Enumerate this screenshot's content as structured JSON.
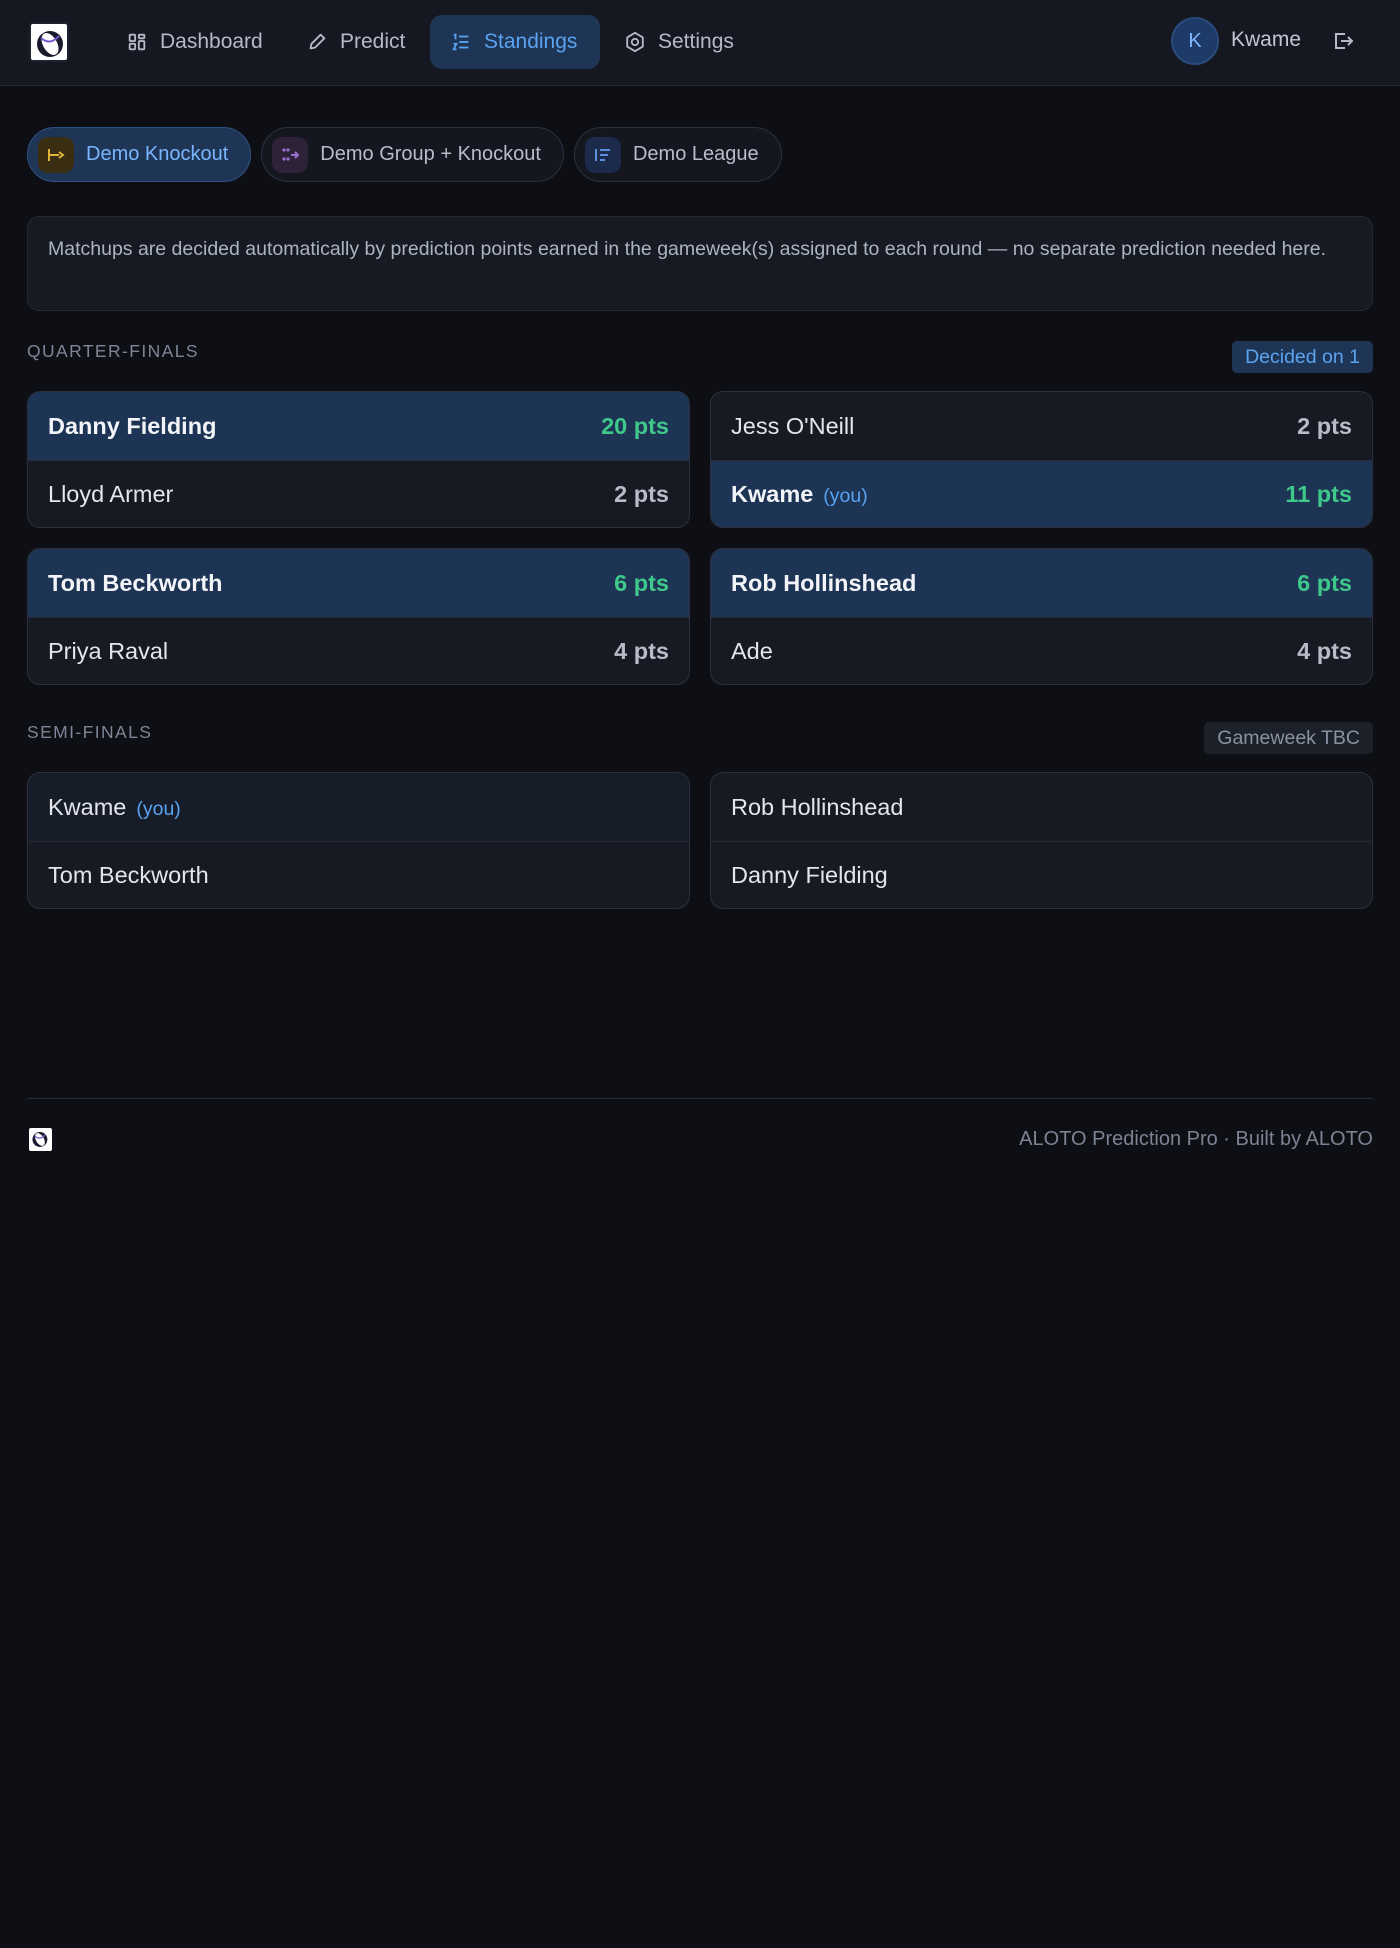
{
  "nav": {
    "items": [
      {
        "label": "Dashboard",
        "icon": "dashboard-icon"
      },
      {
        "label": "Predict",
        "icon": "pencil-icon"
      },
      {
        "label": "Standings",
        "icon": "list-ordered-icon",
        "active": true
      },
      {
        "label": "Settings",
        "icon": "gear-icon"
      }
    ],
    "user": {
      "initial": "K",
      "name": "Kwame"
    }
  },
  "tabs": [
    {
      "label": "Demo Knockout",
      "icon": "bracket-icon",
      "active": true
    },
    {
      "label": "Demo Group + Knockout",
      "icon": "group-knockout-icon"
    },
    {
      "label": "Demo League",
      "icon": "league-table-icon"
    }
  ],
  "info_text": "Matchups are decided automatically by prediction points earned in the gameweek(s) assigned to each round — no separate prediction needed here.",
  "rounds": [
    {
      "label": "QUARTER-FINALS",
      "badge": "Decided on 1",
      "matches": [
        {
          "home": {
            "name": "Danny Fielding",
            "pts": "20 pts",
            "winner": true
          },
          "away": {
            "name": "Lloyd Armer",
            "pts": "2 pts"
          }
        },
        {
          "home": {
            "name": "Jess O'Neill",
            "pts": "2 pts"
          },
          "away": {
            "name": "Kwame",
            "you": "(you)",
            "pts": "11 pts",
            "winner": true
          }
        },
        {
          "home": {
            "name": "Tom Beckworth",
            "pts": "6 pts",
            "winner": true
          },
          "away": {
            "name": "Priya Raval",
            "pts": "4 pts"
          }
        },
        {
          "home": {
            "name": "Rob Hollinshead",
            "pts": "6 pts",
            "winner": true
          },
          "away": {
            "name": "Ade",
            "pts": "4 pts"
          }
        }
      ]
    },
    {
      "label": "SEMI-FINALS",
      "badge": "Gameweek TBC",
      "matches": [
        {
          "home": {
            "name": "Kwame",
            "you": "(you)"
          },
          "away": {
            "name": "Tom Beckworth"
          }
        },
        {
          "home": {
            "name": "Rob Hollinshead"
          },
          "away": {
            "name": "Danny Fielding"
          }
        }
      ]
    }
  ],
  "footer": {
    "text": "ALOTO Prediction Pro · Built by ALOTO"
  },
  "colors": {
    "accent": "#5aa3f0",
    "win": "#3ec98a",
    "background": "#0e0f14"
  }
}
